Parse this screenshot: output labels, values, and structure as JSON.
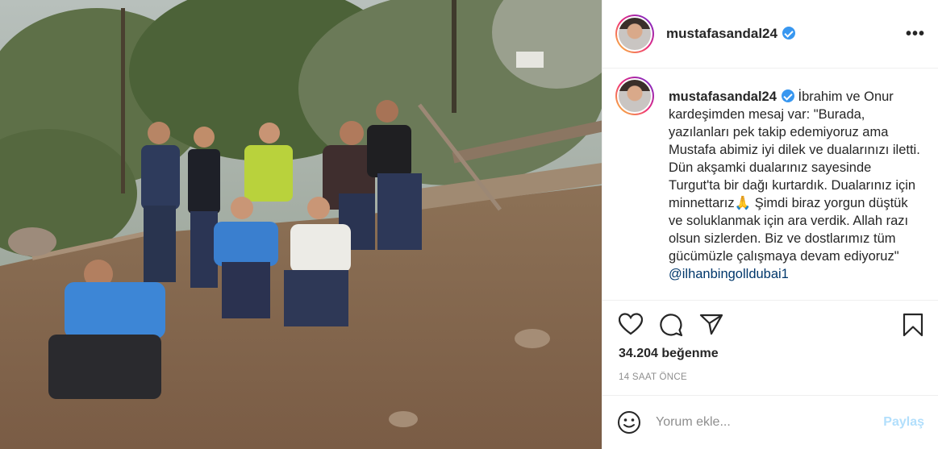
{
  "post": {
    "username": "mustafasandal24",
    "caption_text": " İbrahim ve Onur kardeşimden mesaj var: \"Burada, yazılanları pek takip edemiyoruz ama Mustafa abimiz iyi dilek ve dualarınızı iletti. Dün akşamki dualarınız sayesinde Turgut'ta bir dağı kurtardık. Dualarınız için minnettarız🙏 Şimdi biraz yorgun düştük ve soluklanmak için ara verdik. Allah razı olsun sizlerden. Biz ve dostlarımız tüm gücümüzle çalışmaya devam ediyoruz\" ",
    "caption_link": "@ilhanbingolldubai1",
    "likes": "34.204 beğenme",
    "time_ago": "14 SAAT ÖNCE",
    "comment_placeholder": "Yorum ekle...",
    "share_label": "Paylaş",
    "more_label": "•••"
  },
  "icons": {
    "like": "heart-icon",
    "comment": "comment-icon",
    "share": "send-icon",
    "save": "bookmark-icon",
    "emoji": "emoji-icon",
    "verified": "verified-badge-icon"
  },
  "colors": {
    "verified": "#3897f0",
    "share_disabled": "#b2dffc",
    "border": "#efefef",
    "muted": "#8e8e8e"
  }
}
